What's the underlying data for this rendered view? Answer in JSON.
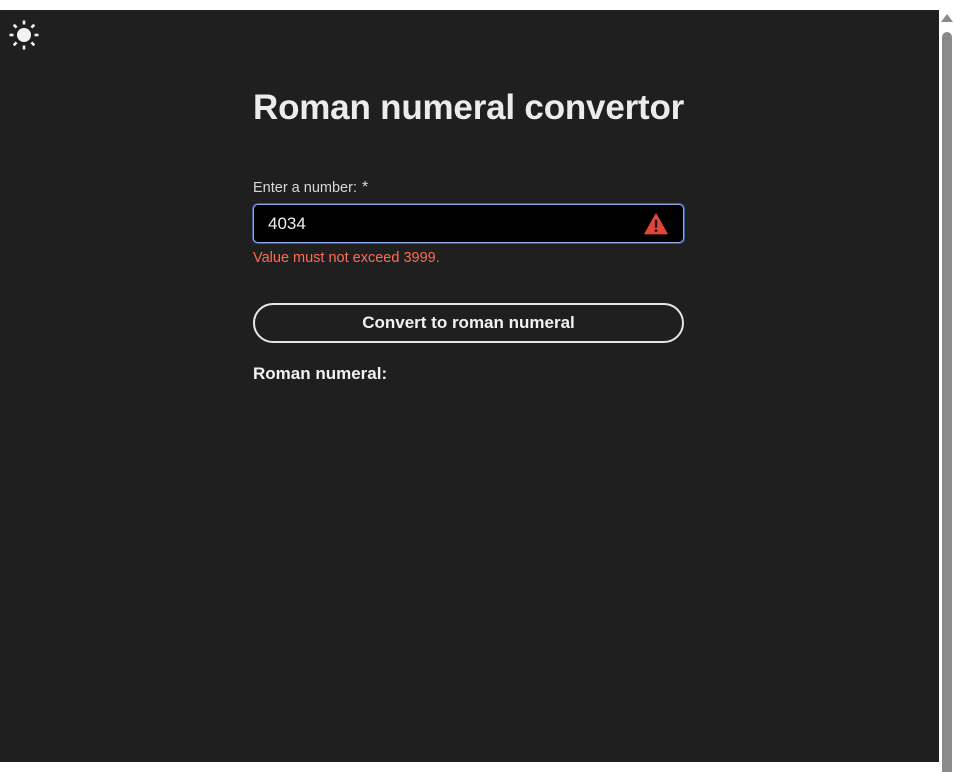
{
  "header": {
    "theme_toggle_icon": "sun-icon"
  },
  "main": {
    "title": "Roman numeral convertor",
    "number_field": {
      "label": "Enter a number:",
      "required_marker": "*",
      "value": "4034",
      "error_icon": "warning-triangle-icon",
      "error_message": "Value must not exceed 3999."
    },
    "convert_button_label": "Convert to roman numeral",
    "result": {
      "label": "Roman numeral:",
      "value": ""
    }
  },
  "colors": {
    "background": "#1f1f1f",
    "input_background": "#000000",
    "input_focus_border": "#8ea9e8",
    "error": "#ff6b57",
    "warning_icon": "#e0443a",
    "text": "#ececec"
  },
  "scrollbar": {
    "up_arrow_icon": "scroll-up-arrow-icon"
  }
}
